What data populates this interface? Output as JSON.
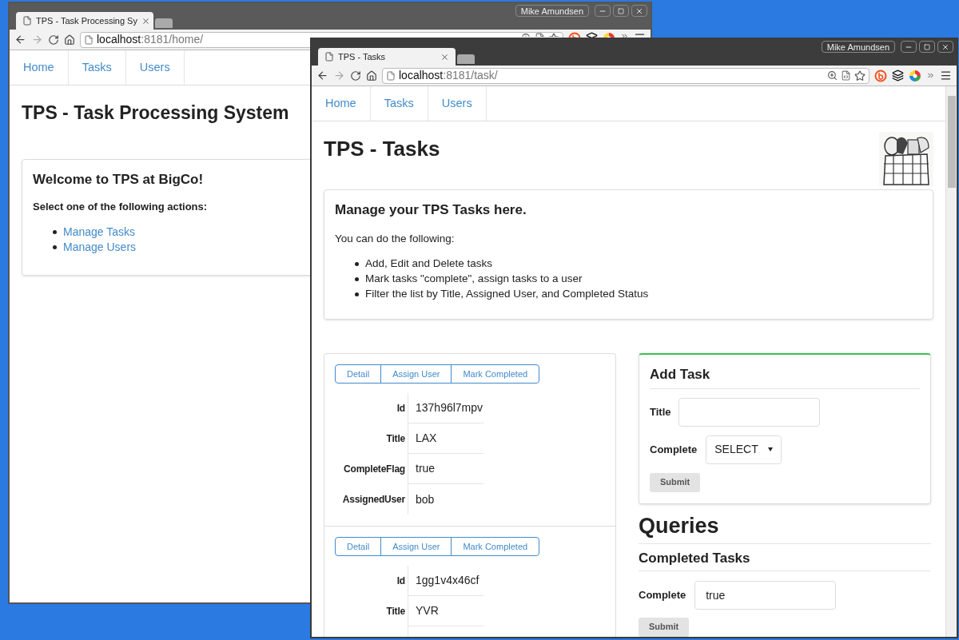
{
  "back_window": {
    "user": "Mike Amundsen",
    "tab": {
      "title": "TPS - Task Processing Sy"
    },
    "url": {
      "host": "localhost",
      "path": ":8181/home/"
    },
    "nav": [
      {
        "label": "Home"
      },
      {
        "label": "Tasks"
      },
      {
        "label": "Users"
      }
    ],
    "heading": "TPS - Task Processing System",
    "card": {
      "title": "Welcome to TPS at BigCo!",
      "prompt": "Select one of the following actions:",
      "links": [
        "Manage Tasks",
        "Manage Users"
      ]
    }
  },
  "front_window": {
    "user": "Mike Amundsen",
    "tab": {
      "title": "TPS - Tasks"
    },
    "url": {
      "host": "localhost",
      "path": ":8181/task/"
    },
    "nav": [
      {
        "label": "Home"
      },
      {
        "label": "Tasks"
      },
      {
        "label": "Users"
      }
    ],
    "heading": "TPS - Tasks",
    "intro": {
      "title": "Manage your TPS Tasks here.",
      "text": "You can do the following:",
      "items": [
        "Add, Edit and Delete tasks",
        "Mark tasks \"complete\", assign tasks to a user",
        "Filter the list by Title, Assigned User, and Completed Status"
      ]
    },
    "tasks": [
      {
        "actions": [
          "Detail",
          "Assign User",
          "Mark Completed"
        ],
        "fields": [
          {
            "label": "Id",
            "value": "137h96l7mpv"
          },
          {
            "label": "Title",
            "value": "LAX"
          },
          {
            "label": "CompleteFlag",
            "value": "true"
          },
          {
            "label": "AssignedUser",
            "value": "bob"
          }
        ]
      },
      {
        "actions": [
          "Detail",
          "Assign User",
          "Mark Completed"
        ],
        "fields": [
          {
            "label": "Id",
            "value": "1gg1v4x46cf"
          },
          {
            "label": "Title",
            "value": "YVR"
          }
        ]
      }
    ],
    "add_task": {
      "title": "Add Task",
      "fields": [
        {
          "kind": "text",
          "label": "Title"
        },
        {
          "kind": "select",
          "label": "Complete",
          "value": "SELECT"
        }
      ],
      "submit": "Submit"
    },
    "queries": {
      "title": "Queries",
      "sections": [
        {
          "title": "Completed Tasks",
          "field": {
            "label": "Complete",
            "value": "true"
          },
          "submit": "Submit"
        }
      ]
    }
  }
}
